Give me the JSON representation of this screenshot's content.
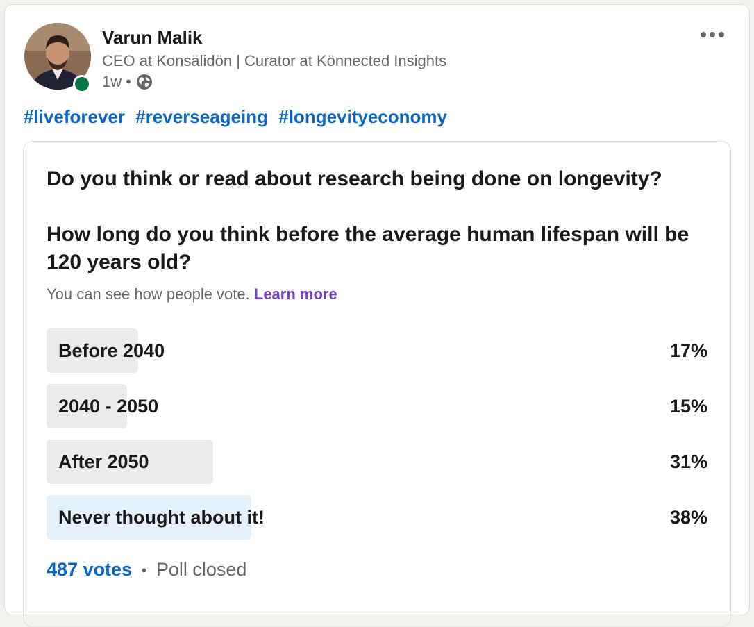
{
  "author": {
    "name": "Varun Malik",
    "headline": "CEO at Konsälidön | Curator at Könnected Insights",
    "time": "1w",
    "separator": "•",
    "visibility_icon": "globe-icon",
    "presence_color": "#057642"
  },
  "more_icon": "more-horizontal-icon",
  "hashtags": [
    "#liveforever",
    "#reverseageing",
    "#longevityeconomy"
  ],
  "poll": {
    "question_line1": "Do you think or read about research being done on longevity?",
    "question_line2": "How long do you think before the average human lifespan will be 120 years old?",
    "visibility_text": "You can see how people vote.",
    "learn_more": "Learn more",
    "options": [
      {
        "label": "Before 2040",
        "percent_text": "17%",
        "percent": 17,
        "selected": false
      },
      {
        "label": "2040 - 2050",
        "percent_text": "15%",
        "percent": 15,
        "selected": false
      },
      {
        "label": "After 2050",
        "percent_text": "31%",
        "percent": 31,
        "selected": false
      },
      {
        "label": "Never thought about it!",
        "percent_text": "38%",
        "percent": 38,
        "selected": true
      }
    ],
    "votes": "487 votes",
    "separator": "•",
    "status": "Poll closed"
  },
  "colors": {
    "link_blue": "#0a66c2",
    "learn_more_purple": "#7a3ec6",
    "bar_default": "#ebebeb",
    "bar_selected": "#e4f0fb"
  }
}
